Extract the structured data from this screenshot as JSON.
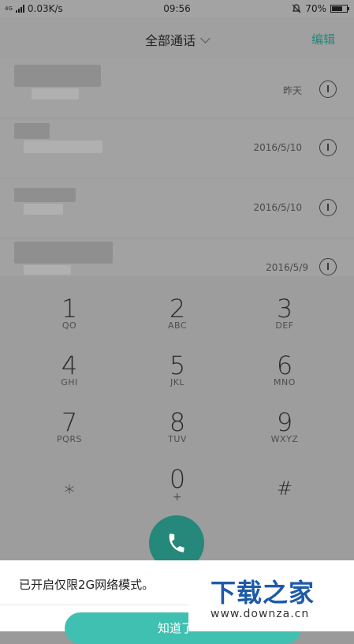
{
  "status_bar": {
    "network": "4G",
    "speed": "0.03K/s",
    "time": "09:56",
    "battery_percent": "70%",
    "battery_level": 0.7,
    "icons": [
      "signal-icon",
      "alarm-icon",
      "battery-icon"
    ]
  },
  "header": {
    "title": "全部通话",
    "edit_label": "编辑"
  },
  "calls": [
    {
      "date": "昨天"
    },
    {
      "date": "2016/5/10"
    },
    {
      "date": "2016/5/10"
    },
    {
      "date": "2016/5/9"
    }
  ],
  "keypad": {
    "keys": [
      {
        "digit": "1",
        "letters": "QO"
      },
      {
        "digit": "2",
        "letters": "ABC"
      },
      {
        "digit": "3",
        "letters": "DEF"
      },
      {
        "digit": "4",
        "letters": "GHI"
      },
      {
        "digit": "5",
        "letters": "JKL"
      },
      {
        "digit": "6",
        "letters": "MNO"
      },
      {
        "digit": "7",
        "letters": "PQRS"
      },
      {
        "digit": "8",
        "letters": "TUV"
      },
      {
        "digit": "9",
        "letters": "WXYZ"
      },
      {
        "digit": "⁎",
        "letters": ""
      },
      {
        "digit": "0",
        "letters": "+"
      },
      {
        "digit": "#",
        "letters": ""
      }
    ]
  },
  "toast": {
    "message": "已开启仅限2G网络模式。",
    "button_label": "知道了"
  },
  "watermark": {
    "logo": "下载之家",
    "url": "www.downza.cn"
  },
  "colors": {
    "accent": "#25887a",
    "toast_button": "#40c0b0",
    "watermark_blue": "#1e5aa8"
  }
}
